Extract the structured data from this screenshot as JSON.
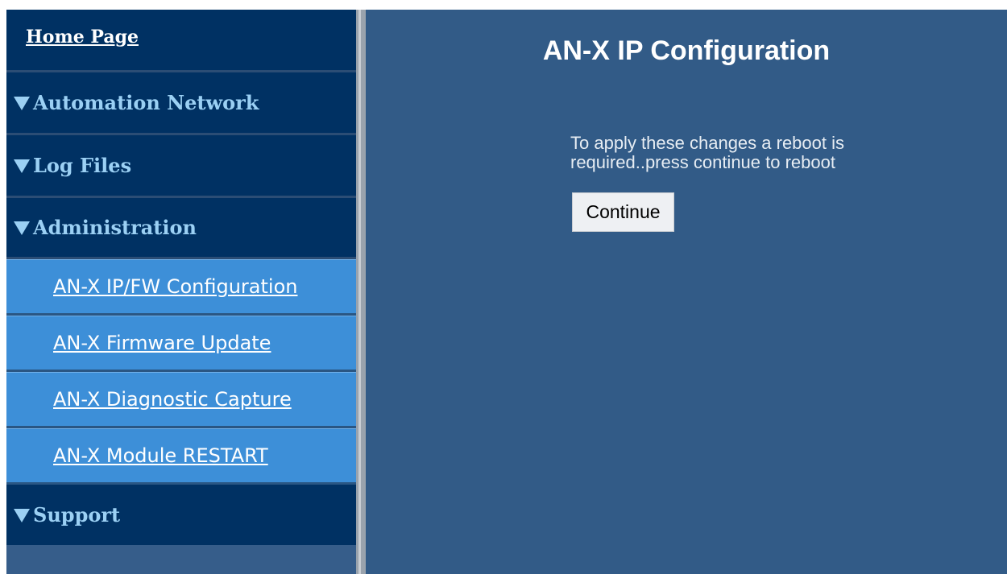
{
  "sidebar": {
    "home_link": "Home Page",
    "sections": [
      {
        "label": "Automation Network"
      },
      {
        "label": "Log Files"
      },
      {
        "label": "Administration"
      }
    ],
    "admin_items": [
      {
        "label": "AN-X IP/FW Configuration"
      },
      {
        "label": "AN-X Firmware Update"
      },
      {
        "label": "AN-X Diagnostic Capture"
      },
      {
        "label": "AN-X Module RESTART"
      }
    ],
    "support": {
      "label": "Support"
    },
    "icon": "triangle-down-icon"
  },
  "main": {
    "title": "AN-X IP Configuration",
    "message": "To apply these changes a reboot is required..press continue to reboot",
    "continue_label": "Continue"
  },
  "colors": {
    "sidebar_header_bg": "#003163",
    "sidebar_sub_bg": "#3d8fd8",
    "section_text": "#9bd0f4",
    "main_bg": "#325b87",
    "sidebar_bg": "#365d8a"
  }
}
